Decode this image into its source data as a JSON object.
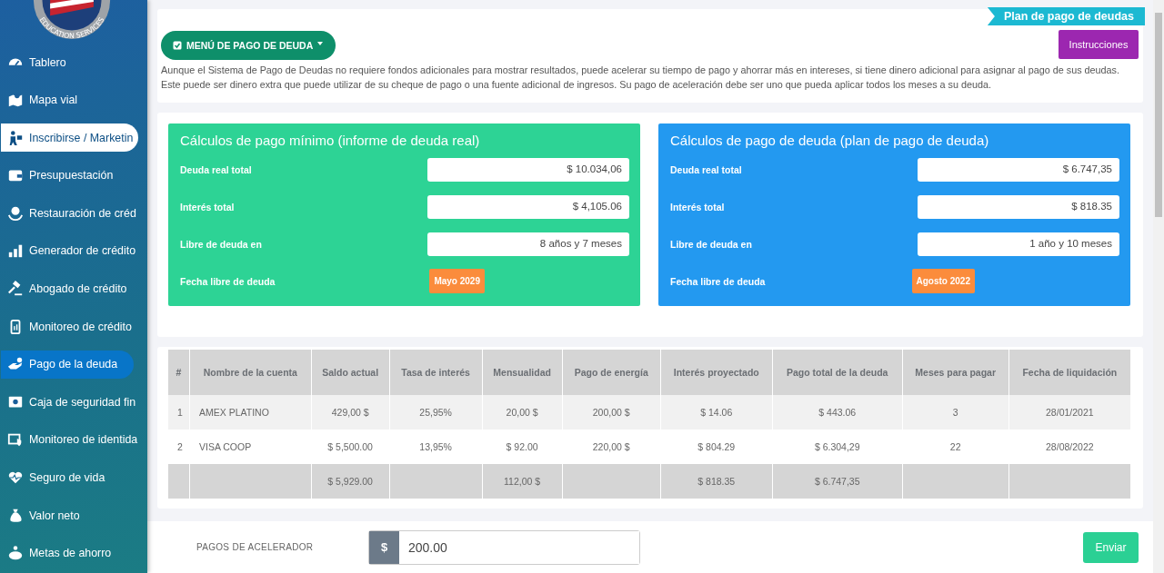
{
  "sidebar": {
    "logo_text": "EDUCATION SERVICES",
    "items": [
      {
        "label": "Tablero",
        "selected": false,
        "hovered": false
      },
      {
        "label": "Mapa vial",
        "selected": false,
        "hovered": false
      },
      {
        "label": "Inscribirse / Marketin",
        "selected": false,
        "hovered": true
      },
      {
        "label": "Presupuestación",
        "selected": false,
        "hovered": false
      },
      {
        "label": "Restauración de créd",
        "selected": false,
        "hovered": false
      },
      {
        "label": "Generador de crédito",
        "selected": false,
        "hovered": false
      },
      {
        "label": "Abogado de crédito",
        "selected": false,
        "hovered": false
      },
      {
        "label": "Monitoreo de crédito",
        "selected": false,
        "hovered": false
      },
      {
        "label": "Pago de la deuda",
        "selected": true,
        "hovered": false
      },
      {
        "label": "Caja de seguridad fin",
        "selected": false,
        "hovered": false
      },
      {
        "label": "Monitoreo de identida",
        "selected": false,
        "hovered": false
      },
      {
        "label": "Seguro de vida",
        "selected": false,
        "hovered": false
      },
      {
        "label": "Valor neto",
        "selected": false,
        "hovered": false
      },
      {
        "label": "Metas de ahorro",
        "selected": false,
        "hovered": false
      }
    ]
  },
  "header": {
    "ribbon": "Plan de pago de deudas",
    "menu_button": "MENÚ DE PAGO DE DEUDA",
    "instructions_button": "Instrucciones",
    "description": "Aunque el Sistema de Pago de Deudas no requiere fondos adicionales para mostrar resultados, puede acelerar su tiempo de pago y ahorrar más en intereses, si tiene dinero adicional para asignar al pago de sus deudas. Este puede ser dinero extra que puede utilizar de su cheque de pago o una fuente adicional de ingresos. Su pago de aceleración debe ser uno que pueda aplicar todos los meses a su deuda."
  },
  "panels": [
    {
      "title": "Cálculos de pago mínimo (informe de deuda real)",
      "color": "#2dd395",
      "rows": [
        {
          "label": "Deuda real total",
          "value": "$ 10.034,06",
          "kind": "field"
        },
        {
          "label": "Interés total",
          "value": "$ 4,105.06",
          "kind": "field"
        },
        {
          "label": "Libre de deuda en",
          "value": "8 años y 7 meses",
          "kind": "field"
        },
        {
          "label": "Fecha libre de deuda",
          "value": "Mayo 2029",
          "kind": "badge"
        }
      ]
    },
    {
      "title": "Cálculos de pago de deuda (plan de pago de deuda)",
      "color": "#2399f0",
      "rows": [
        {
          "label": "Deuda real total",
          "value": "$ 6.747,35",
          "kind": "field"
        },
        {
          "label": "Interés total",
          "value": "$ 818.35",
          "kind": "field"
        },
        {
          "label": "Libre de deuda en",
          "value": "1 año y 10 meses",
          "kind": "field"
        },
        {
          "label": "Fecha libre de deuda",
          "value": "Agosto 2022",
          "kind": "badge"
        }
      ]
    }
  ],
  "table": {
    "columns": [
      "#",
      "Nombre de la cuenta",
      "Saldo actual",
      "Tasa de interés",
      "Mensualidad",
      "Pago de energía",
      "Interés proyectado",
      "Pago total de la deuda",
      "Meses para pagar",
      "Fecha de liquidación"
    ],
    "rows": [
      [
        "1",
        "AMEX PLATINO",
        "429,00 $",
        "25,95%",
        "20,00 $",
        "200,00 $",
        "$ 14.06",
        "$ 443.06",
        "3",
        "28/01/2021"
      ],
      [
        "2",
        "VISA COOP",
        "$ 5,500.00",
        "13,95%",
        "$ 92.00",
        "220,00 $",
        "$ 804.29",
        "$ 6.304,29",
        "22",
        "28/08/2022"
      ]
    ],
    "totals": {
      "saldo_actual": "$ 5,929.00",
      "mensualidad": "112,00 $",
      "interes_proyectado": "$ 818.35",
      "pago_total": "$ 6.747,35"
    }
  },
  "accelerator": {
    "label": "PAGOS DE ACELERADOR",
    "currency": "$",
    "value": "200.00",
    "submit": "Enviar"
  }
}
